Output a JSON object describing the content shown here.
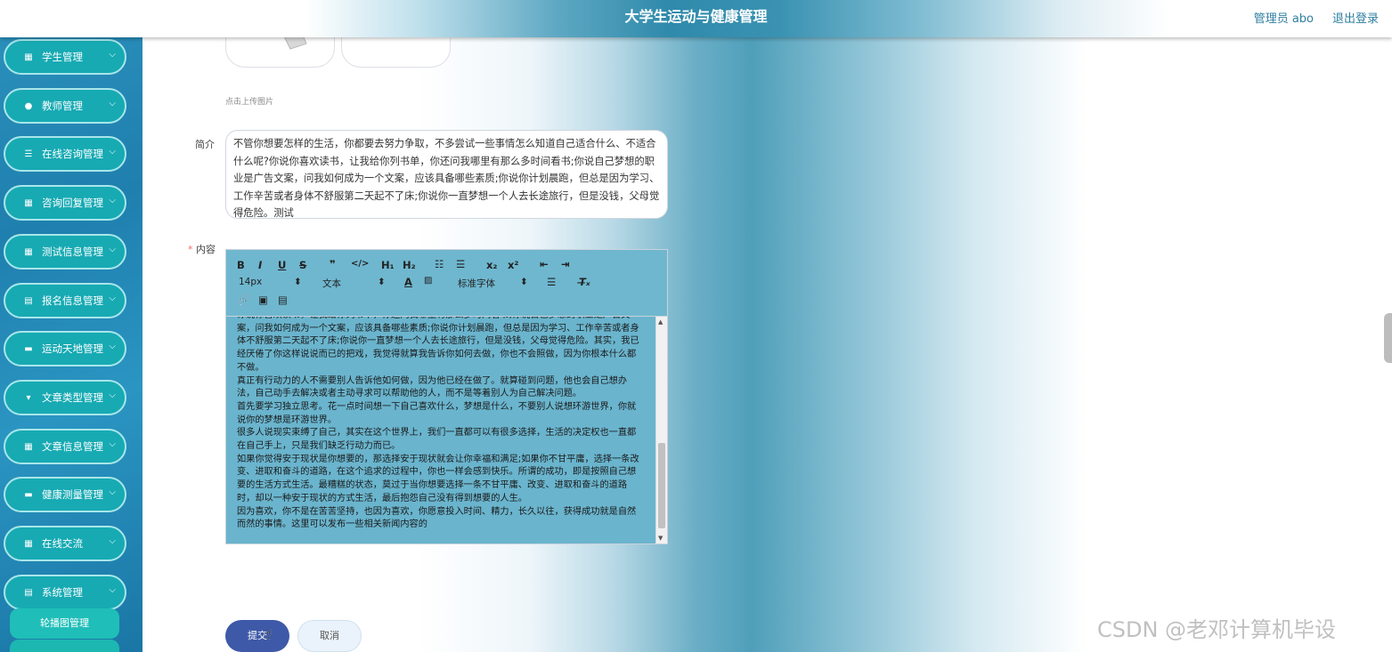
{
  "header": {
    "title": "大学生运动与健康管理",
    "user": "管理员 abo",
    "logout": "退出登录"
  },
  "sidebar": {
    "items": [
      {
        "label": "学生管理",
        "icon": "▦"
      },
      {
        "label": "教师管理",
        "icon": "👤"
      },
      {
        "label": "在线咨询管理",
        "icon": "☰"
      },
      {
        "label": "咨询回复管理",
        "icon": "▦"
      },
      {
        "label": "测试信息管理",
        "icon": "▦"
      },
      {
        "label": "报名信息管理",
        "icon": "▤"
      },
      {
        "label": "运动天地管理",
        "icon": "▬"
      },
      {
        "label": "文章类型管理",
        "icon": "▾"
      },
      {
        "label": "文章信息管理",
        "icon": "▦"
      },
      {
        "label": "健康测量管理",
        "icon": "▬"
      },
      {
        "label": "在线交流",
        "icon": "▦"
      },
      {
        "label": "系统管理",
        "icon": "▤"
      }
    ],
    "sub_item": "轮播图管理"
  },
  "form": {
    "upload_hint": "点击上传图片",
    "intro_label": "简介",
    "intro_value": "不管你想要怎样的生活，你都要去努力争取，不多尝试一些事情怎么知道自己适合什么、不适合什么呢?你说你喜欢读书，让我给你列书单，你还问我哪里有那么多时间看书;你说自己梦想的职业是广告文案，问我如何成为一个文案，应该具备哪些素质;你说你计划晨跑，但总是因为学习、工作辛苦或者身体不舒服第二天起不了床;你说你一直梦想一个人去长途旅行，但是没钱，父母觉得危险。测试",
    "content_required": "*",
    "content_label": "内容",
    "content_paragraphs": [
      "你说你喜欢读书，让我给你列书单，你还问我哪里有那么多时间看书;你说自己梦想的职业是广告文案，问我如何成为一个文案，应该具备哪些素质;你说你计划晨跑，但总是因为学习、工作辛苦或者身体不舒服第二天起不了床;你说你一直梦想一个人去长途旅行，但是没钱，父母觉得危险。其实，我已经厌倦了你这样说说而已的把戏，我觉得就算我告诉你如何去做，你也不会照做，因为你根本什么都不做。",
      "真正有行动力的人不需要别人告诉他如何做，因为他已经在做了。就算碰到问题，他也会自己想办法，自己动手去解决或者主动寻求可以帮助他的人，而不是等着别人为自己解决问题。",
      "首先要学习独立思考。花一点时间想一下自己喜欢什么，梦想是什么，不要别人说想环游世界，你就说你的梦想是环游世界。",
      "很多人说现实束缚了自己，其实在这个世界上，我们一直都可以有很多选择，生活的决定权也一直都在自己手上，只是我们缺乏行动力而已。",
      "如果你觉得安于现状是你想要的，那选择安于现状就会让你幸福和满足;如果你不甘平庸，选择一条改变、进取和奋斗的道路，在这个追求的过程中，你也一样会感到快乐。所谓的成功，即是按照自己想要的生活方式生活。最糟糕的状态，莫过于当你想要选择一条不甘平庸、改变、进取和奋斗的道路时，却以一种安于现状的方式生活，最后抱怨自己没有得到想要的人生。",
      "因为喜欢，你不是在苦苦坚持，也因为喜欢，你愿意投入时间、精力，长久以往，获得成功就是自然而然的事情。这里可以发布一些相关新闻内容的"
    ],
    "toolbar": {
      "font_size": "14px",
      "header": "文本",
      "font_family": "标准字体"
    },
    "submit": "提交",
    "cancel": "取消"
  },
  "watermark": "CSDN @老邓计算机毕设"
}
